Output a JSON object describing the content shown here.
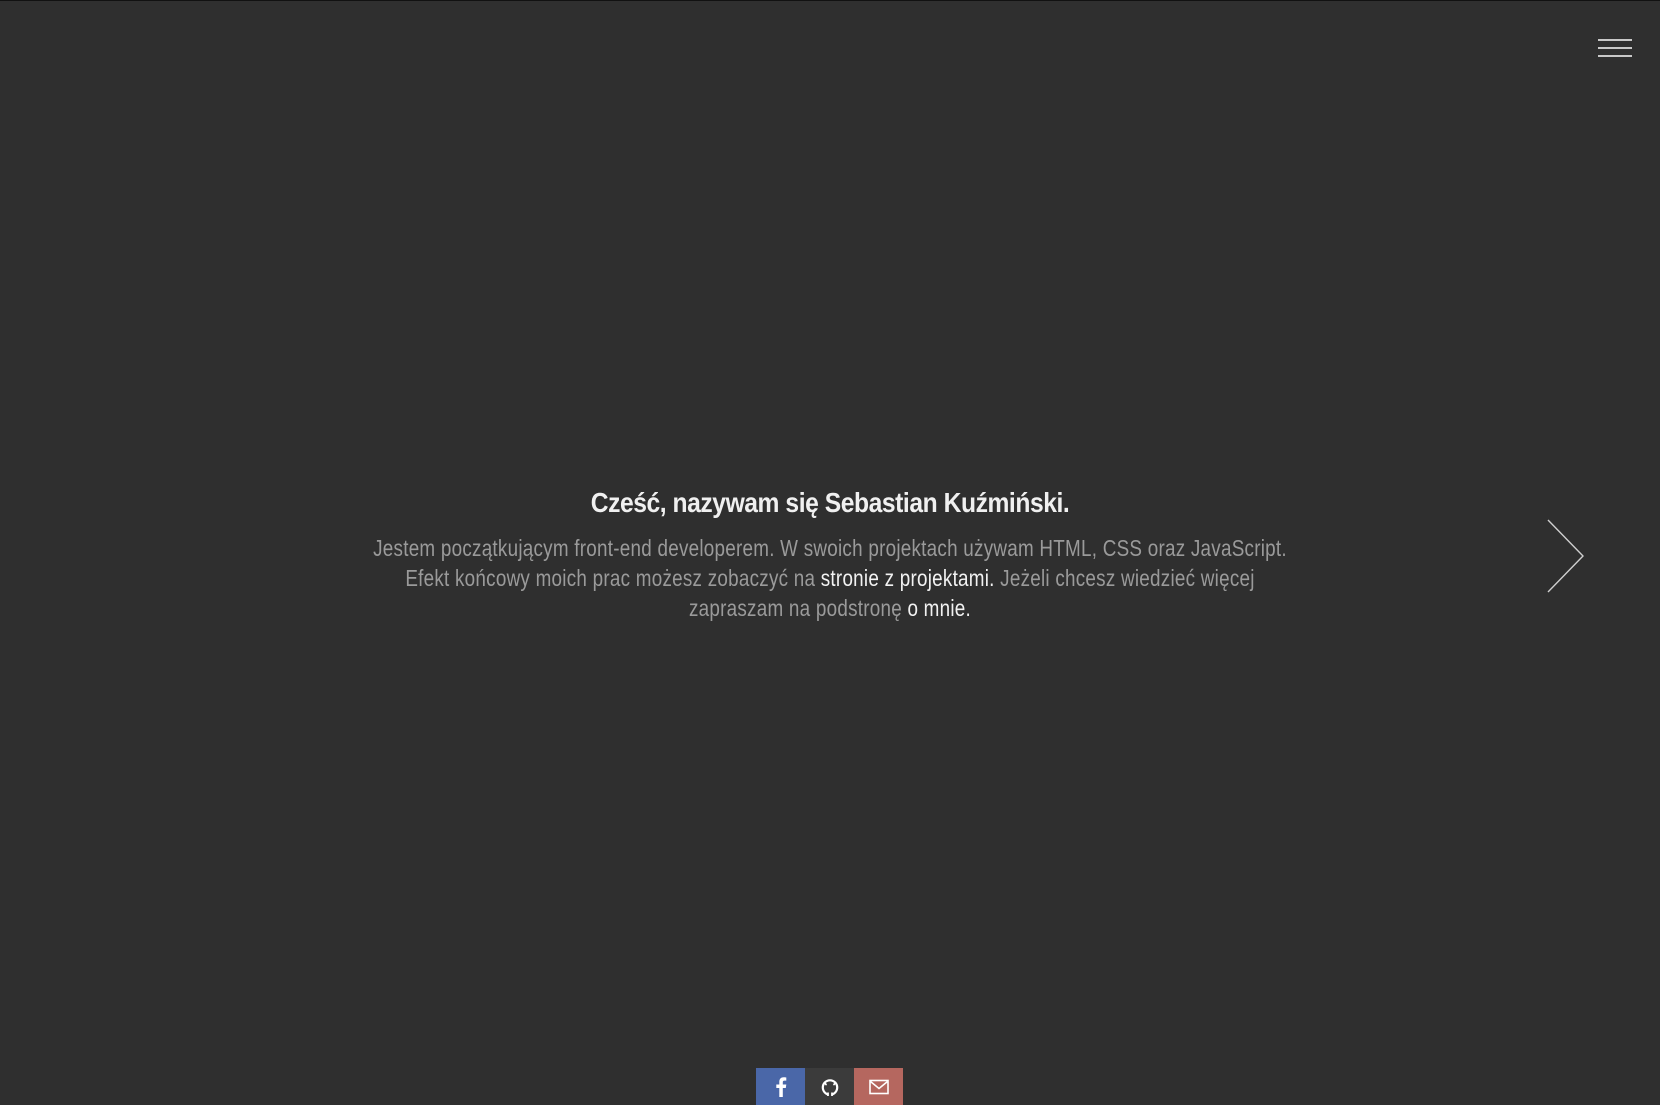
{
  "colors": {
    "background": "#2f2f2f",
    "title": "#f0f0f0",
    "text": "#9a9a9a",
    "link": "#f2f2f2",
    "facebook": "#4a67a8",
    "github": "#3b3b3b",
    "email": "#b5675f"
  },
  "header": {
    "menu_icon": "hamburger-icon"
  },
  "hero": {
    "title": "Cześć, nazywam się Sebastian Kuźmiński.",
    "text_part1": "Jestem początkującym front-end developerem. W swoich projektach używam HTML, CSS oraz JavaScript. Efekt końcowy moich prac możesz zobaczyć na ",
    "link_projects": "stronie z projektami.",
    "text_part2": " Jeżeli chcesz wiedzieć więcej zapraszam na podstronę ",
    "link_about": "o mnie."
  },
  "navigation": {
    "next_icon": "chevron-right-icon"
  },
  "social": [
    {
      "name": "facebook",
      "icon": "facebook-icon"
    },
    {
      "name": "github",
      "icon": "github-icon"
    },
    {
      "name": "email",
      "icon": "envelope-icon"
    }
  ]
}
